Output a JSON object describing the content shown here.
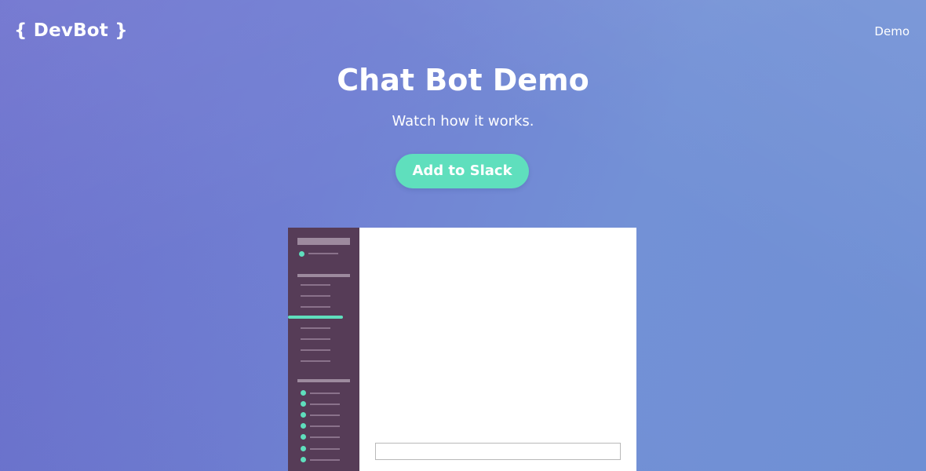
{
  "header": {
    "logo_text": "{ DevBot }",
    "nav": [
      {
        "label": "Demo"
      }
    ]
  },
  "hero": {
    "title": "Chat Bot Demo",
    "subtitle": "Watch how it works.",
    "cta_label": "Add to Slack"
  },
  "colors": {
    "background_start": "#6f73cf",
    "background_end": "#7391d6",
    "accent": "#5fdfbd",
    "slack_sidebar": "#563c57",
    "text": "#ffffff"
  },
  "demo": {
    "message_input_value": ""
  }
}
